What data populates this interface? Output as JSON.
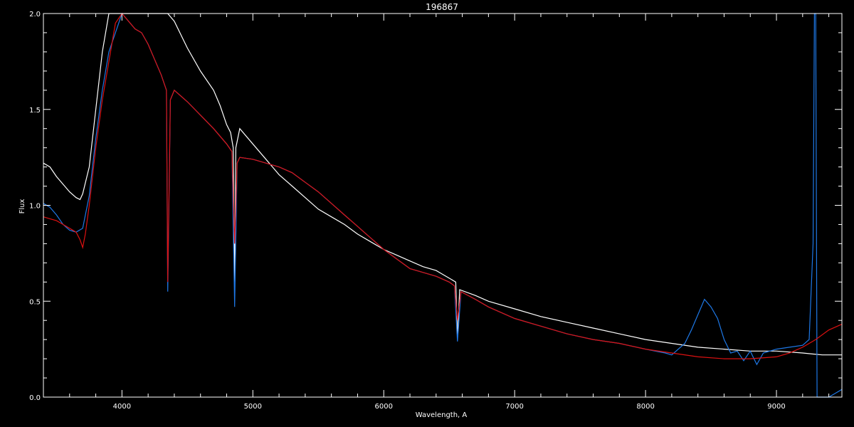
{
  "chart_data": {
    "type": "line",
    "title": "196867",
    "xlabel": "Wavelength, A",
    "ylabel": "Flux",
    "xlim": [
      3400,
      9500
    ],
    "ylim": [
      0.0,
      2.0
    ],
    "x_ticks": [
      4000,
      5000,
      6000,
      7000,
      8000,
      9000
    ],
    "y_ticks": [
      0.0,
      0.5,
      1.0,
      1.5,
      2.0
    ],
    "y_tick_labels": [
      "0.0",
      "0.5",
      "1.0",
      "1.5",
      "2.0"
    ],
    "background": "#000000",
    "grid": false,
    "series": [
      {
        "color": "#ffffff",
        "points": [
          [
            3400,
            1.22
          ],
          [
            3450,
            1.2
          ],
          [
            3500,
            1.15
          ],
          [
            3550,
            1.11
          ],
          [
            3600,
            1.07
          ],
          [
            3650,
            1.04
          ],
          [
            3680,
            1.03
          ],
          [
            3700,
            1.06
          ],
          [
            3750,
            1.2
          ],
          [
            3800,
            1.5
          ],
          [
            3850,
            1.8
          ],
          [
            3900,
            2.0
          ],
          [
            4000,
            2.0
          ],
          [
            4100,
            2.0
          ],
          [
            4200,
            2.0
          ],
          [
            4300,
            2.0
          ],
          [
            4350,
            2.0
          ],
          [
            4400,
            1.96
          ],
          [
            4500,
            1.82
          ],
          [
            4600,
            1.7
          ],
          [
            4700,
            1.6
          ],
          [
            4750,
            1.52
          ],
          [
            4800,
            1.42
          ],
          [
            4830,
            1.38
          ],
          [
            4850,
            1.3
          ],
          [
            4860,
            0.6
          ],
          [
            4870,
            1.3
          ],
          [
            4900,
            1.4
          ],
          [
            5000,
            1.32
          ],
          [
            5100,
            1.24
          ],
          [
            5200,
            1.16
          ],
          [
            5300,
            1.1
          ],
          [
            5400,
            1.04
          ],
          [
            5500,
            0.98
          ],
          [
            5600,
            0.94
          ],
          [
            5700,
            0.9
          ],
          [
            5800,
            0.85
          ],
          [
            5900,
            0.81
          ],
          [
            6000,
            0.77
          ],
          [
            6100,
            0.74
          ],
          [
            6200,
            0.71
          ],
          [
            6300,
            0.68
          ],
          [
            6400,
            0.66
          ],
          [
            6500,
            0.62
          ],
          [
            6550,
            0.6
          ],
          [
            6563,
            0.3
          ],
          [
            6580,
            0.56
          ],
          [
            6700,
            0.53
          ],
          [
            6800,
            0.5
          ],
          [
            7000,
            0.46
          ],
          [
            7200,
            0.42
          ],
          [
            7400,
            0.39
          ],
          [
            7600,
            0.36
          ],
          [
            7800,
            0.33
          ],
          [
            8000,
            0.3
          ],
          [
            8200,
            0.28
          ],
          [
            8400,
            0.26
          ],
          [
            8600,
            0.25
          ],
          [
            8800,
            0.24
          ],
          [
            9000,
            0.24
          ],
          [
            9200,
            0.23
          ],
          [
            9350,
            0.22
          ],
          [
            9500,
            0.22
          ]
        ]
      },
      {
        "color": "#1e78e6",
        "points": [
          [
            3400,
            1.01
          ],
          [
            3450,
            0.99
          ],
          [
            3500,
            0.95
          ],
          [
            3550,
            0.9
          ],
          [
            3600,
            0.87
          ],
          [
            3650,
            0.86
          ],
          [
            3700,
            0.88
          ],
          [
            3750,
            1.05
          ],
          [
            3800,
            1.35
          ],
          [
            3850,
            1.6
          ],
          [
            3900,
            1.8
          ],
          [
            4000,
            2.0
          ],
          [
            4100,
            1.92
          ],
          [
            4150,
            1.9
          ],
          [
            4200,
            1.84
          ],
          [
            4250,
            1.76
          ],
          [
            4300,
            1.68
          ],
          [
            4340,
            1.6
          ],
          [
            4350,
            0.55
          ],
          [
            4370,
            1.55
          ],
          [
            4400,
            1.6
          ],
          [
            4500,
            1.54
          ],
          [
            4600,
            1.47
          ],
          [
            4700,
            1.4
          ],
          [
            4800,
            1.32
          ],
          [
            4840,
            1.28
          ],
          [
            4861,
            0.47
          ],
          [
            4880,
            1.22
          ],
          [
            4900,
            1.25
          ],
          [
            5000,
            1.24
          ],
          [
            5100,
            1.22
          ],
          [
            5200,
            1.2
          ],
          [
            5300,
            1.17
          ],
          [
            5400,
            1.12
          ],
          [
            5500,
            1.07
          ],
          [
            5600,
            1.01
          ],
          [
            5700,
            0.95
          ],
          [
            5800,
            0.89
          ],
          [
            5900,
            0.83
          ],
          [
            6000,
            0.77
          ],
          [
            6100,
            0.72
          ],
          [
            6200,
            0.67
          ],
          [
            6300,
            0.65
          ],
          [
            6400,
            0.63
          ],
          [
            6500,
            0.6
          ],
          [
            6540,
            0.58
          ],
          [
            6563,
            0.29
          ],
          [
            6590,
            0.55
          ],
          [
            6700,
            0.51
          ],
          [
            6800,
            0.47
          ],
          [
            6900,
            0.44
          ],
          [
            7000,
            0.41
          ],
          [
            7200,
            0.37
          ],
          [
            7400,
            0.33
          ],
          [
            7600,
            0.3
          ],
          [
            7800,
            0.28
          ],
          [
            8000,
            0.25
          ],
          [
            8150,
            0.23
          ],
          [
            8200,
            0.22
          ],
          [
            8300,
            0.28
          ],
          [
            8350,
            0.35
          ],
          [
            8400,
            0.43
          ],
          [
            8450,
            0.51
          ],
          [
            8500,
            0.47
          ],
          [
            8550,
            0.41
          ],
          [
            8600,
            0.3
          ],
          [
            8650,
            0.23
          ],
          [
            8700,
            0.24
          ],
          [
            8750,
            0.19
          ],
          [
            8800,
            0.24
          ],
          [
            8850,
            0.17
          ],
          [
            8900,
            0.23
          ],
          [
            9000,
            0.25
          ],
          [
            9100,
            0.26
          ],
          [
            9200,
            0.27
          ],
          [
            9250,
            0.3
          ],
          [
            9280,
            0.8
          ],
          [
            9290,
            2.0
          ],
          [
            9300,
            2.0
          ],
          [
            9310,
            0.0
          ],
          [
            9400,
            0.0
          ],
          [
            9450,
            0.02
          ],
          [
            9500,
            0.04
          ]
        ]
      },
      {
        "color": "#dd1111",
        "points": [
          [
            3400,
            0.94
          ],
          [
            3450,
            0.93
          ],
          [
            3500,
            0.92
          ],
          [
            3550,
            0.9
          ],
          [
            3600,
            0.88
          ],
          [
            3650,
            0.86
          ],
          [
            3680,
            0.82
          ],
          [
            3700,
            0.78
          ],
          [
            3720,
            0.85
          ],
          [
            3750,
            1.0
          ],
          [
            3800,
            1.3
          ],
          [
            3850,
            1.55
          ],
          [
            3900,
            1.75
          ],
          [
            3950,
            1.95
          ],
          [
            4000,
            2.0
          ],
          [
            4100,
            1.92
          ],
          [
            4150,
            1.9
          ],
          [
            4200,
            1.84
          ],
          [
            4250,
            1.76
          ],
          [
            4300,
            1.68
          ],
          [
            4340,
            1.6
          ],
          [
            4350,
            0.6
          ],
          [
            4370,
            1.55
          ],
          [
            4400,
            1.6
          ],
          [
            4500,
            1.54
          ],
          [
            4600,
            1.47
          ],
          [
            4700,
            1.4
          ],
          [
            4800,
            1.32
          ],
          [
            4840,
            1.28
          ],
          [
            4861,
            0.8
          ],
          [
            4880,
            1.22
          ],
          [
            4900,
            1.25
          ],
          [
            5000,
            1.24
          ],
          [
            5100,
            1.22
          ],
          [
            5200,
            1.2
          ],
          [
            5300,
            1.17
          ],
          [
            5400,
            1.12
          ],
          [
            5500,
            1.07
          ],
          [
            5600,
            1.01
          ],
          [
            5700,
            0.95
          ],
          [
            5800,
            0.89
          ],
          [
            5900,
            0.83
          ],
          [
            6000,
            0.77
          ],
          [
            6100,
            0.72
          ],
          [
            6200,
            0.67
          ],
          [
            6300,
            0.65
          ],
          [
            6400,
            0.63
          ],
          [
            6500,
            0.6
          ],
          [
            6540,
            0.58
          ],
          [
            6563,
            0.4
          ],
          [
            6590,
            0.55
          ],
          [
            6700,
            0.51
          ],
          [
            6800,
            0.47
          ],
          [
            6900,
            0.44
          ],
          [
            7000,
            0.41
          ],
          [
            7200,
            0.37
          ],
          [
            7400,
            0.33
          ],
          [
            7600,
            0.3
          ],
          [
            7800,
            0.28
          ],
          [
            8000,
            0.25
          ],
          [
            8200,
            0.23
          ],
          [
            8400,
            0.21
          ],
          [
            8600,
            0.2
          ],
          [
            8800,
            0.2
          ],
          [
            9000,
            0.21
          ],
          [
            9100,
            0.23
          ],
          [
            9200,
            0.26
          ],
          [
            9300,
            0.3
          ],
          [
            9400,
            0.35
          ],
          [
            9500,
            0.38
          ]
        ]
      }
    ]
  }
}
